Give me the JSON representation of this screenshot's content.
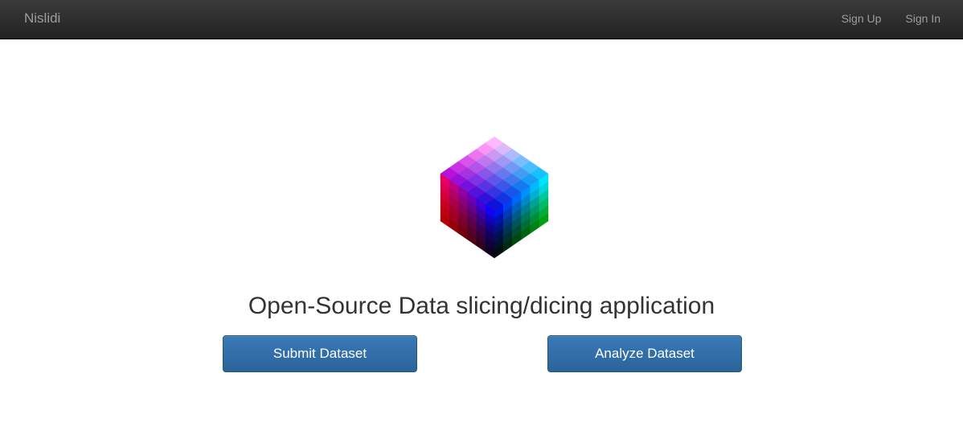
{
  "navbar": {
    "brand": "Nislidi",
    "links": [
      {
        "label": "Sign Up"
      },
      {
        "label": "Sign In"
      }
    ]
  },
  "hero": {
    "logo_icon": "rgb-color-cube-icon",
    "headline": "Open-Source Data slicing/dicing application"
  },
  "actions": {
    "submit_label": "Submit Dataset",
    "analyze_label": "Analyze Dataset"
  },
  "colors": {
    "navbar": "#222222",
    "nav_text": "#9d9d9d",
    "button": "#337ab7",
    "headline": "#333333"
  }
}
